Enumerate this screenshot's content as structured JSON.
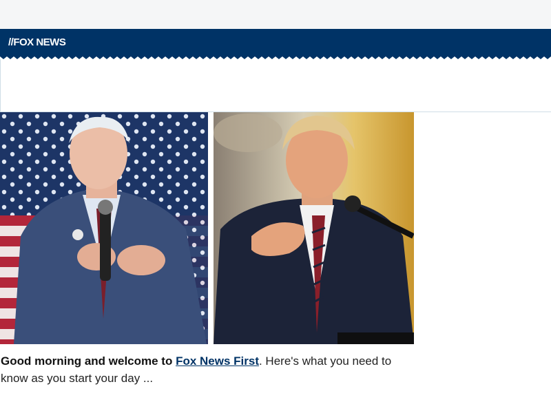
{
  "header": {
    "logo_text": "FOX NEWS",
    "brand_color": "#003366"
  },
  "images": {
    "left": {
      "subject": "biden-speaking-photo"
    },
    "right": {
      "subject": "trump-speaking-photo"
    }
  },
  "intro": {
    "greeting": "Good morning and welcome to ",
    "link_text": "Fox News First",
    "after_link": ". Here's what you need to know as you start your day ..."
  }
}
